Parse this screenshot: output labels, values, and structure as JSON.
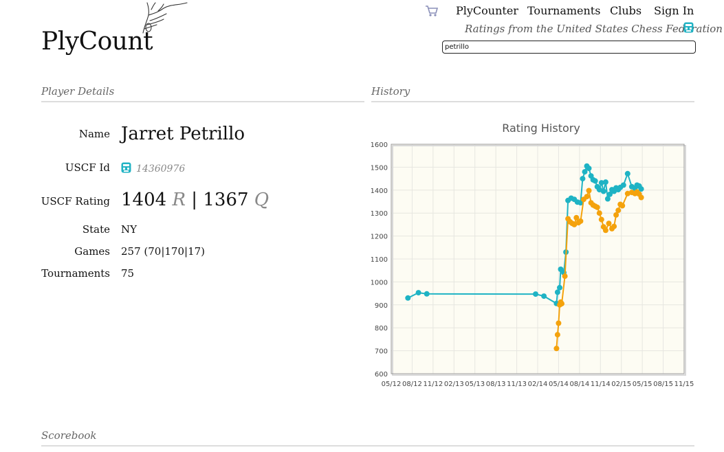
{
  "header": {
    "logo": "PlyCount",
    "nav": {
      "plycounter": "PlyCounter",
      "tournaments": "Tournaments",
      "clubs": "Clubs",
      "signin": "Sign In"
    },
    "tagline": "Ratings from the United States Chess Federation",
    "search_value": "petrillo"
  },
  "player_details": {
    "section_title": "Player Details",
    "name_label": "Name",
    "name": "Jarret Petrillo",
    "uscf_id_label": "USCF Id",
    "uscf_id": "14360976",
    "rating_label": "USCF Rating",
    "regular_rating": "1404",
    "regular_suffix": "R",
    "separator": "|",
    "quick_rating": "1367",
    "quick_suffix": "Q",
    "state_label": "State",
    "state": "NY",
    "games_label": "Games",
    "games": "257 (70|170|17)",
    "tournaments_label": "Tournaments",
    "tournaments": "75"
  },
  "history": {
    "section_title": "History"
  },
  "scorebook": {
    "section_title": "Scorebook"
  },
  "colors": {
    "series_regular": "#1eb3c4",
    "series_quick": "#f4a20c",
    "plot_bg": "#fdfcf3"
  },
  "chart_data": {
    "type": "line",
    "title": "Rating History",
    "xlabel": "",
    "ylabel": "",
    "ylim": [
      600,
      1600
    ],
    "y_ticks": [
      600,
      700,
      800,
      900,
      1000,
      1100,
      1200,
      1300,
      1400,
      1500,
      1600
    ],
    "x_ticks": [
      "05/12",
      "08/12",
      "11/12",
      "02/13",
      "05/13",
      "08/13",
      "11/13",
      "02/14",
      "05/14",
      "08/14",
      "11/14",
      "02/15",
      "05/15",
      "08/15",
      "11/15"
    ],
    "grid": true,
    "series": [
      {
        "color": "#1eb3c4",
        "points": [
          [
            0.8,
            930
          ],
          [
            1.3,
            953
          ],
          [
            1.7,
            948
          ],
          [
            6.9,
            947
          ],
          [
            7.3,
            938
          ],
          [
            7.9,
            906
          ],
          [
            7.95,
            955
          ],
          [
            8.05,
            975
          ],
          [
            8.1,
            1055
          ],
          [
            8.25,
            1040
          ],
          [
            8.35,
            1130
          ],
          [
            8.45,
            1355
          ],
          [
            8.6,
            1365
          ],
          [
            8.75,
            1360
          ],
          [
            8.9,
            1348
          ],
          [
            9.05,
            1345
          ],
          [
            9.15,
            1450
          ],
          [
            9.25,
            1480
          ],
          [
            9.35,
            1505
          ],
          [
            9.45,
            1495
          ],
          [
            9.55,
            1462
          ],
          [
            9.65,
            1445
          ],
          [
            9.75,
            1440
          ],
          [
            9.85,
            1415
          ],
          [
            9.95,
            1402
          ],
          [
            10.05,
            1432
          ],
          [
            10.15,
            1395
          ],
          [
            10.25,
            1435
          ],
          [
            10.35,
            1362
          ],
          [
            10.45,
            1382
          ],
          [
            10.55,
            1402
          ],
          [
            10.65,
            1395
          ],
          [
            10.75,
            1410
          ],
          [
            10.85,
            1402
          ],
          [
            10.95,
            1412
          ],
          [
            11.1,
            1422
          ],
          [
            11.3,
            1472
          ],
          [
            11.5,
            1415
          ],
          [
            11.65,
            1408
          ],
          [
            11.75,
            1422
          ],
          [
            11.85,
            1418
          ],
          [
            11.95,
            1405
          ]
        ]
      },
      {
        "color": "#f4a20c",
        "points": [
          [
            7.9,
            710
          ],
          [
            7.95,
            770
          ],
          [
            8.0,
            820
          ],
          [
            8.05,
            900
          ],
          [
            8.1,
            912
          ],
          [
            8.15,
            905
          ],
          [
            8.3,
            1025
          ],
          [
            8.45,
            1275
          ],
          [
            8.55,
            1262
          ],
          [
            8.65,
            1255
          ],
          [
            8.75,
            1250
          ],
          [
            8.85,
            1280
          ],
          [
            8.95,
            1258
          ],
          [
            9.05,
            1265
          ],
          [
            9.2,
            1360
          ],
          [
            9.35,
            1372
          ],
          [
            9.45,
            1398
          ],
          [
            9.55,
            1345
          ],
          [
            9.65,
            1335
          ],
          [
            9.75,
            1330
          ],
          [
            9.85,
            1325
          ],
          [
            9.95,
            1300
          ],
          [
            10.05,
            1272
          ],
          [
            10.15,
            1240
          ],
          [
            10.25,
            1225
          ],
          [
            10.4,
            1255
          ],
          [
            10.55,
            1232
          ],
          [
            10.65,
            1242
          ],
          [
            10.75,
            1292
          ],
          [
            10.85,
            1312
          ],
          [
            10.95,
            1338
          ],
          [
            11.05,
            1332
          ],
          [
            11.3,
            1385
          ],
          [
            11.5,
            1390
          ],
          [
            11.65,
            1385
          ],
          [
            11.75,
            1392
          ],
          [
            11.85,
            1383
          ],
          [
            11.95,
            1368
          ]
        ]
      }
    ]
  }
}
